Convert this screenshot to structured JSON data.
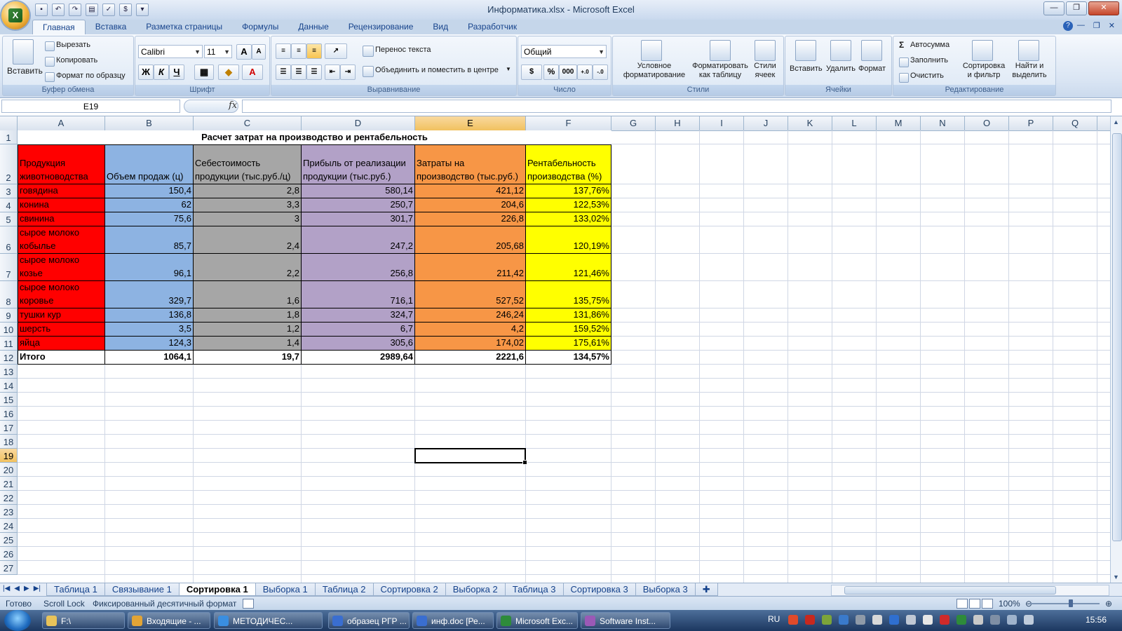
{
  "window": {
    "title": "Информатика.xlsx - Microsoft Excel",
    "office_button_letter": "☻",
    "min": "—",
    "max": "❐",
    "close": "✕"
  },
  "ribbon_tabs": [
    "Главная",
    "Вставка",
    "Разметка страницы",
    "Формулы",
    "Данные",
    "Рецензирование",
    "Вид",
    "Разработчик"
  ],
  "ribbon": {
    "clipboard": {
      "paste": "Вставить",
      "cut": "Вырезать",
      "copy": "Копировать",
      "format_painter": "Формат по образцу",
      "label": "Буфер обмена"
    },
    "font": {
      "name": "Calibri",
      "size": "11",
      "grow": "A",
      "shrink": "A",
      "bold": "Ж",
      "italic": "К",
      "underline": "Ч",
      "color_letter": "А",
      "label": "Шрифт"
    },
    "alignment": {
      "wrap": "Перенос текста",
      "merge": "Объединить и поместить в центре",
      "label": "Выравнивание"
    },
    "number": {
      "format": "Общий",
      "percent": "%",
      "thousands": "000",
      "label": "Число"
    },
    "styles": {
      "conditional": "Условное\nформатирование",
      "as_table": "Форматировать\nкак таблицу",
      "cell_styles": "Стили\nячеек",
      "label": "Стили"
    },
    "cells": {
      "insert": "Вставить",
      "delete": "Удалить",
      "format": "Формат",
      "label": "Ячейки"
    },
    "editing": {
      "autosum": "Автосумма",
      "fill": "Заполнить",
      "clear": "Очистить",
      "sort": "Сортировка\nи фильтр",
      "find": "Найти и\nвыделить",
      "label": "Редактирование"
    }
  },
  "formula_bar": {
    "name_box": "E19",
    "fx": "fx",
    "value": ""
  },
  "columns": [
    "A",
    "B",
    "C",
    "D",
    "E",
    "F",
    "G",
    "H",
    "I",
    "J",
    "K",
    "L",
    "M",
    "N",
    "O",
    "P",
    "Q"
  ],
  "rows": [
    "1",
    "2",
    "3",
    "4",
    "5",
    "6",
    "7",
    "8",
    "9",
    "10",
    "11",
    "12",
    "13",
    "14",
    "15",
    "16",
    "17",
    "18",
    "19",
    "20",
    "21",
    "22",
    "23",
    "24",
    "25",
    "26",
    "27"
  ],
  "sheet": {
    "title": "Расчет затрат на производство и рентабельность",
    "headers": [
      "Продукция животноводства",
      "Объем продаж (ц)",
      "Себестоимость продукции (тыс.руб./ц)",
      "Прибыль от реализации продукции (тыс.руб.)",
      "Затраты на производство (тыс.руб.)",
      "Рентабельность производства (%)"
    ],
    "data_rows": [
      [
        "говядина",
        "150,4",
        "2,8",
        "580,14",
        "421,12",
        "137,76%"
      ],
      [
        "конина",
        "62",
        "3,3",
        "250,7",
        "204,6",
        "122,53%"
      ],
      [
        "свинина",
        "75,6",
        "3",
        "301,7",
        "226,8",
        "133,02%"
      ],
      [
        "сырое молоко кобылье",
        "85,7",
        "2,4",
        "247,2",
        "205,68",
        "120,19%"
      ],
      [
        "сырое молоко козье",
        "96,1",
        "2,2",
        "256,8",
        "211,42",
        "121,46%"
      ],
      [
        "сырое молоко коровье",
        "329,7",
        "1,6",
        "716,1",
        "527,52",
        "135,75%"
      ],
      [
        "тушки кур",
        "136,8",
        "1,8",
        "324,7",
        "246,24",
        "131,86%"
      ],
      [
        "шерсть",
        "3,5",
        "1,2",
        "6,7",
        "4,2",
        "159,52%"
      ],
      [
        "яйца",
        "124,3",
        "1,4",
        "305,6",
        "174,02",
        "175,61%"
      ]
    ],
    "total_row": [
      "Итого",
      "1064,1",
      "19,7",
      "2989,64",
      "2221,6",
      "134,57%"
    ],
    "column_colors": [
      "#ff0000",
      "#8db3e2",
      "#a6a6a6",
      "#b2a1c7",
      "#f79646",
      "#ffff00"
    ]
  },
  "sheet_tabs": [
    "Таблица 1",
    "Связывание 1",
    "Сортировка 1",
    "Выборка 1",
    "Таблица 2",
    "Сортировка 2",
    "Выборка 2",
    "Таблица 3",
    "Сортировка 3",
    "Выборка 3"
  ],
  "active_sheet": "Сортировка 1",
  "status": {
    "ready": "Готово",
    "scroll_lock": "Scroll Lock",
    "decimal": "Фиксированный десятичный формат",
    "zoom": "100%"
  },
  "taskbar": {
    "items": [
      "F:\\",
      "Входящие - ...",
      "МЕТОДИЧЕС...",
      "образец РГР ...",
      "инф.doc [Ре...",
      "Microsoft Exc...",
      "Software Inst..."
    ],
    "lang": "RU",
    "time": "15:56"
  }
}
